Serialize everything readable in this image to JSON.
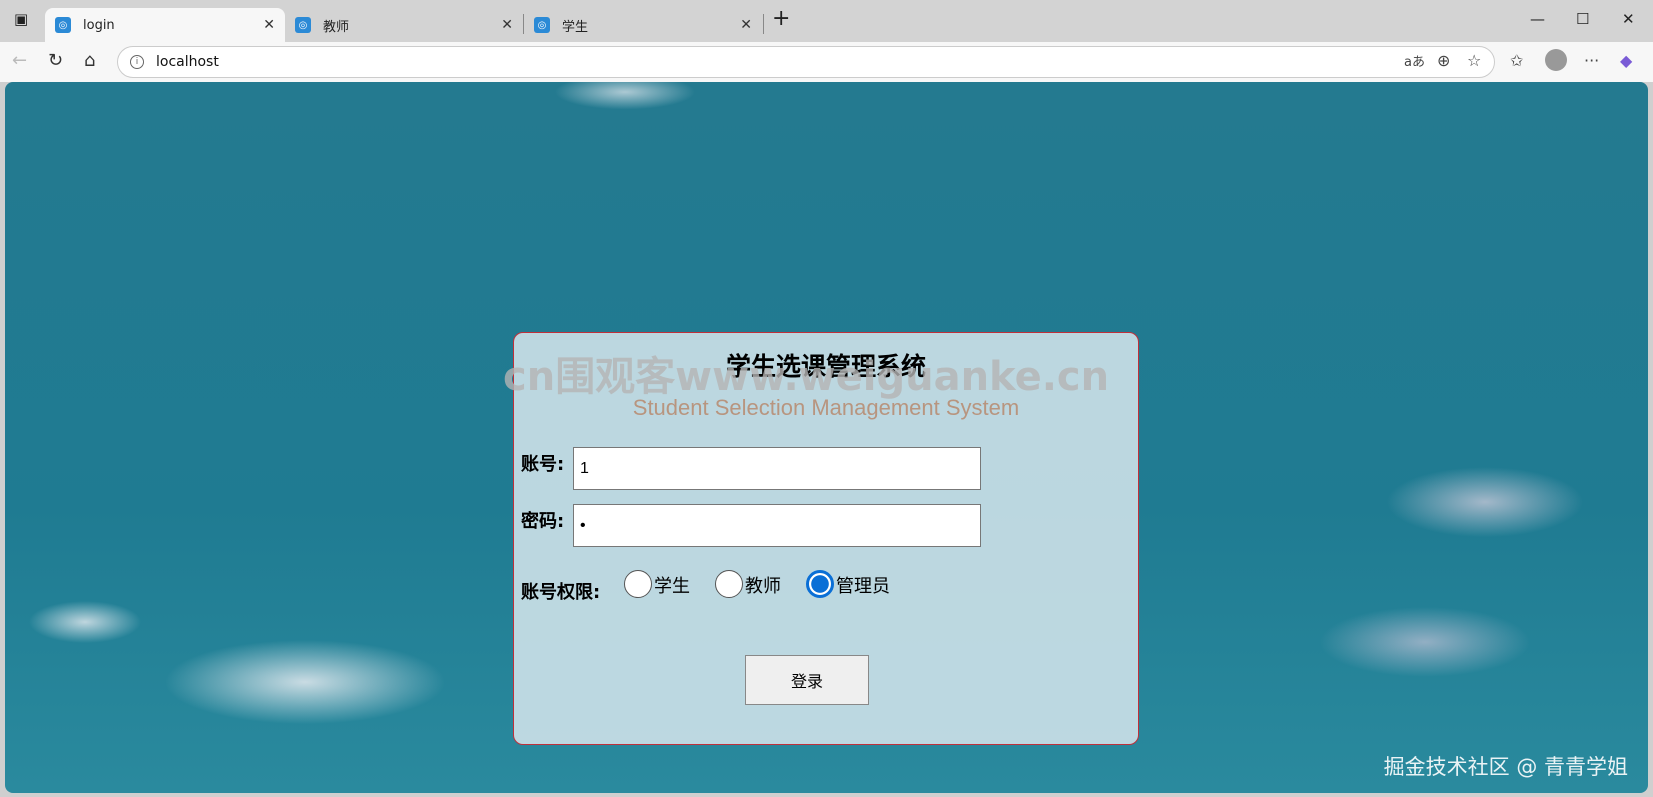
{
  "browser": {
    "tabs": [
      {
        "title": "login",
        "active": true
      },
      {
        "title": "教师",
        "active": false
      },
      {
        "title": "学生",
        "active": false
      }
    ],
    "url": "localhost"
  },
  "login": {
    "title": "学生选课管理系统",
    "subtitle": "Student Selection Management System",
    "account_label": "账号:",
    "account_value": "1",
    "password_label": "密码:",
    "password_value": "•",
    "role_label": "账号权限:",
    "roles": [
      {
        "label": "学生",
        "checked": false
      },
      {
        "label": "教师",
        "checked": false
      },
      {
        "label": "管理员",
        "checked": true
      }
    ],
    "submit_label": "登录"
  },
  "watermarks": {
    "center": "cn围观客www.weiguanke.cn",
    "corner": "掘金技术社区 @ 青青学姐"
  },
  "colors": {
    "accent": "#0a6fd6",
    "card_border": "#c0303a",
    "subtitle": "#b8957f"
  }
}
